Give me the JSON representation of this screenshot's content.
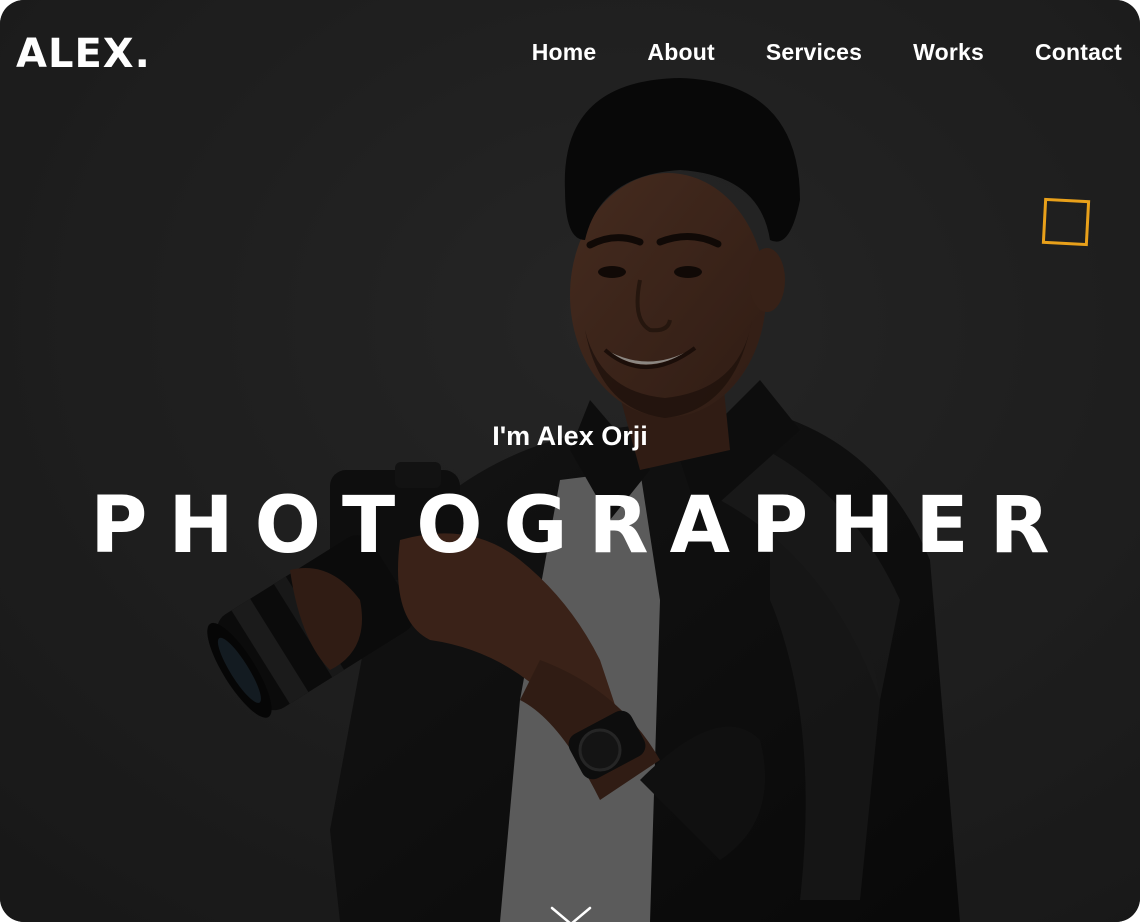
{
  "header": {
    "logo": "ALEX.",
    "nav": [
      {
        "label": "Home"
      },
      {
        "label": "About"
      },
      {
        "label": "Services"
      },
      {
        "label": "Works"
      },
      {
        "label": "Contact"
      }
    ]
  },
  "hero": {
    "intro": "I'm Alex Orji",
    "title": "PHOTOGRAPHER",
    "photo": "photographer-holding-camera",
    "scroll_icon": "chevron-down-icon"
  },
  "colors": {
    "background": "#2b2b2b",
    "text": "#ffffff",
    "accent": "#e8a01a"
  }
}
